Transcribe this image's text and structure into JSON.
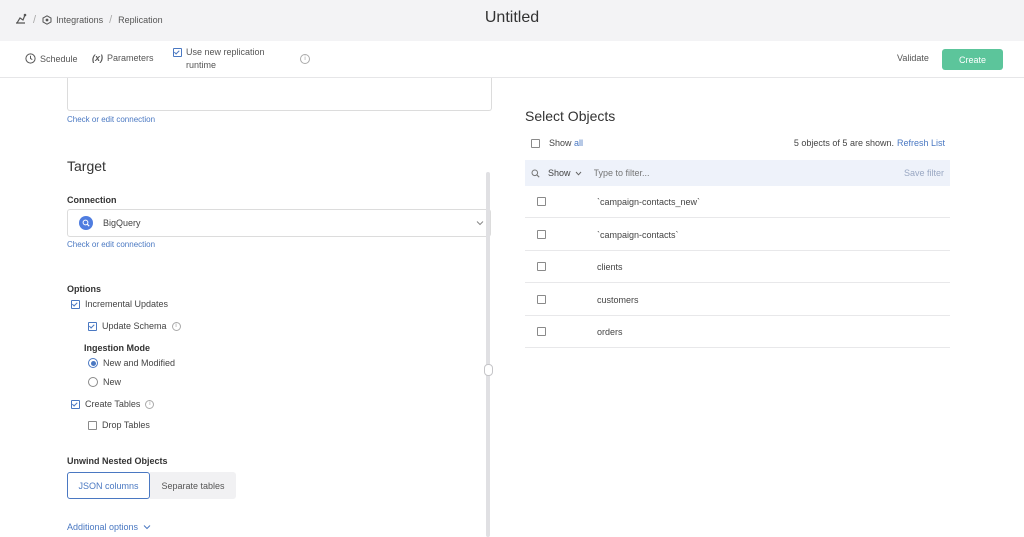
{
  "breadcrumb": {
    "items": [
      "Integrations",
      "Replication"
    ]
  },
  "page_title": "Untitled",
  "toolbar": {
    "schedule": "Schedule",
    "parameters_icon": "(x)",
    "parameters": "Parameters",
    "runtime_line1": "Use new replication",
    "runtime_line2": "runtime",
    "runtime_checked": true,
    "validate": "Validate",
    "create": "Create"
  },
  "source": {
    "check_link": "Check or edit connection"
  },
  "target": {
    "heading": "Target",
    "connection_label": "Connection",
    "connection_value": "BigQuery",
    "check_link": "Check or edit connection",
    "options_label": "Options",
    "incremental_updates": "Incremental Updates",
    "update_schema": "Update Schema",
    "ingestion_mode_label": "Ingestion Mode",
    "mode_new_modified": "New and Modified",
    "mode_new": "New",
    "create_tables": "Create Tables",
    "drop_tables": "Drop Tables",
    "unwind_label": "Unwind Nested Objects",
    "json_columns": "JSON columns",
    "separate_tables": "Separate tables",
    "additional_options": "Additional options"
  },
  "objects": {
    "heading": "Select Objects",
    "show": "Show",
    "all": "all",
    "summary": "5 objects of 5 are shown.",
    "refresh": "Refresh List",
    "filter_show": "Show",
    "filter_placeholder": "Type to filter...",
    "save_filter": "Save filter",
    "items": [
      "`campaign-contacts_new`",
      "`campaign-contacts`",
      "clients",
      "customers",
      "orders"
    ]
  },
  "colors": {
    "accent": "#4a78c2",
    "create_button": "#5cc59b"
  }
}
